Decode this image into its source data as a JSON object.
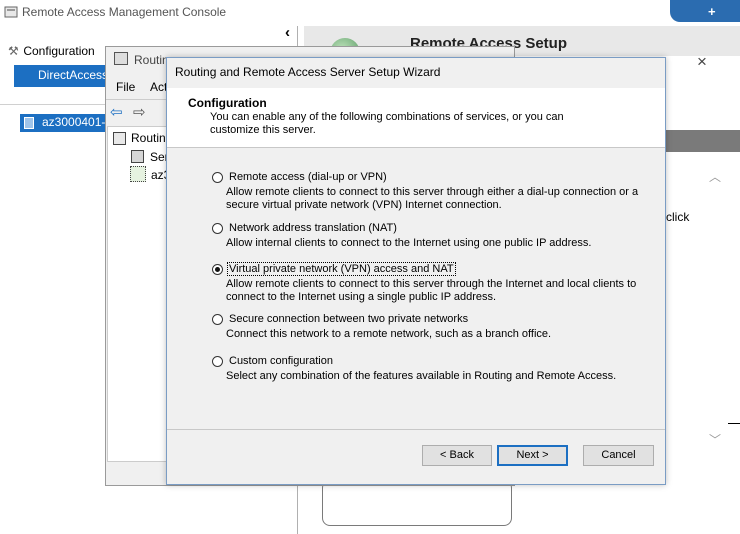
{
  "console": {
    "title": "Remote Access Management Console",
    "configuration_label": "Configuration",
    "directaccess_label": "DirectAccess",
    "server_label": "az3000401-",
    "collapse_glyph": "‹",
    "setup_banner_title": "Remote Access Setup",
    "close_glyph": "×",
    "click_text": "click",
    "top_button_glyph": "+"
  },
  "routing_window": {
    "title": "Routin",
    "menu": {
      "file": "File",
      "action": "Act"
    },
    "tree": {
      "root": "Routin",
      "server_status": "Ser",
      "server": "az3"
    }
  },
  "wizard": {
    "title": "Routing and Remote Access Server Setup Wizard",
    "heading": "Configuration",
    "description": "You can enable any of the following combinations of services, or you can customize this server.",
    "options": [
      {
        "label": "Remote access (dial-up or VPN)",
        "description": "Allow remote clients to connect to this server through either a dial-up connection or a secure virtual private network (VPN) Internet connection.",
        "selected": false
      },
      {
        "label": "Network address translation (NAT)",
        "description": "Allow internal clients to connect to the Internet using one public IP address.",
        "selected": false
      },
      {
        "label": "Virtual private network (VPN) access and NAT",
        "description": "Allow remote clients to connect to this server through the Internet and local clients to connect to the Internet using a single public IP address.",
        "selected": true
      },
      {
        "label": "Secure connection between two private networks",
        "description": "Connect this network to a remote network, such as a branch office.",
        "selected": false
      },
      {
        "label": "Custom configuration",
        "description": "Select any combination of the features available in Routing and Remote Access.",
        "selected": false
      }
    ],
    "buttons": {
      "back": "< Back",
      "next": "Next >",
      "cancel": "Cancel"
    }
  }
}
